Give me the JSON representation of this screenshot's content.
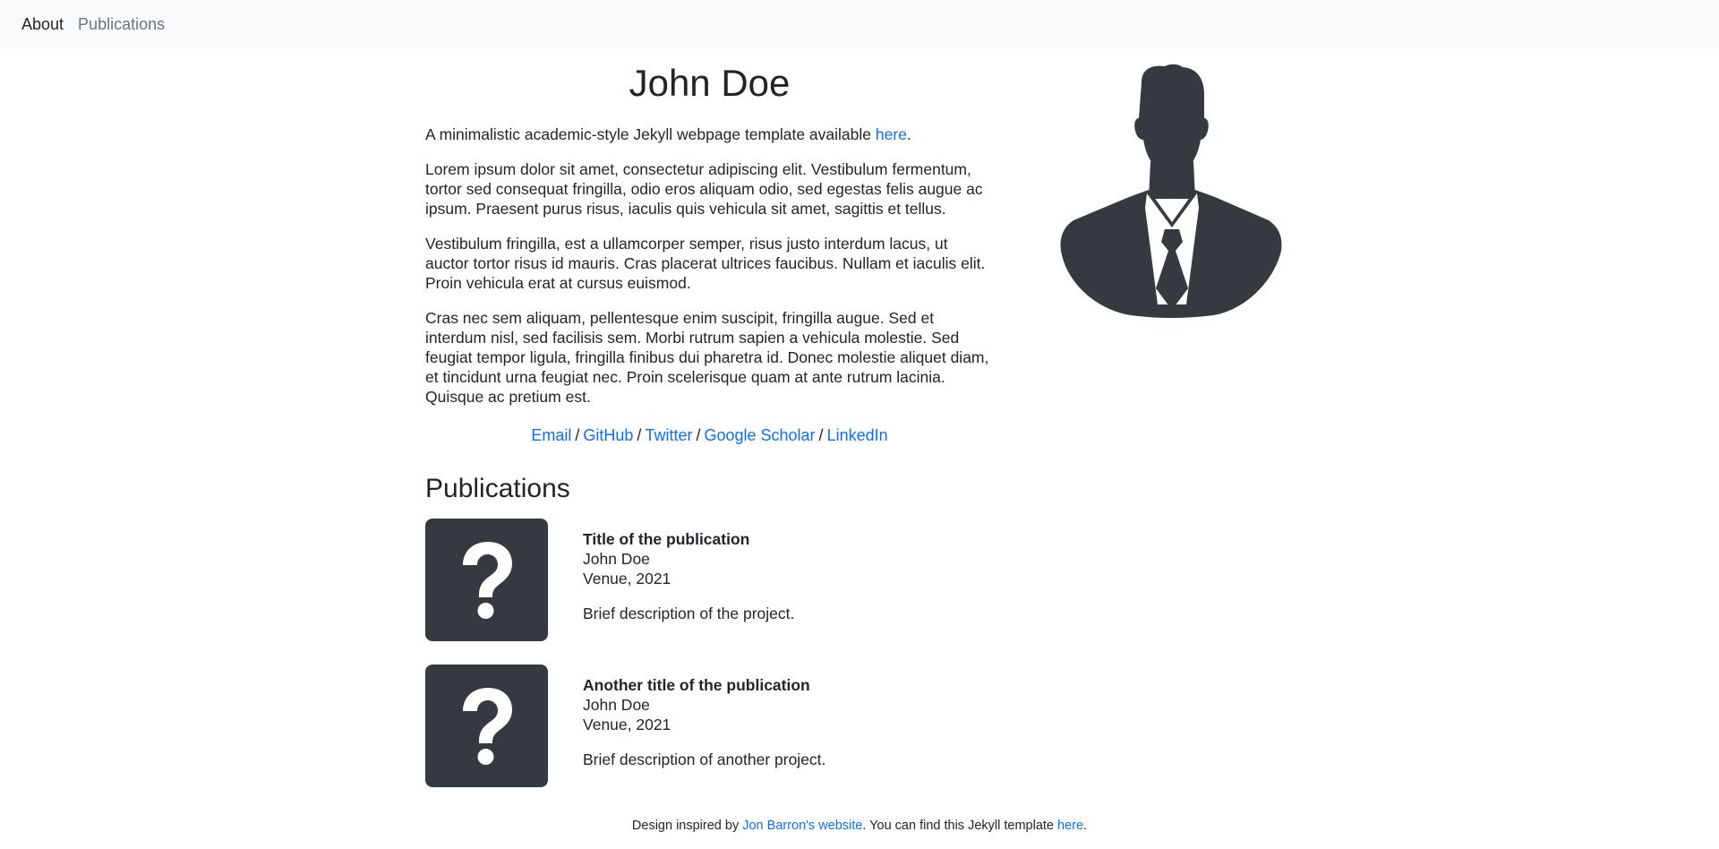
{
  "nav": {
    "items": [
      {
        "label": "About"
      },
      {
        "label": "Publications"
      }
    ]
  },
  "profile": {
    "name": "John Doe",
    "intro_prefix": "A minimalistic academic-style Jekyll webpage template available ",
    "intro_link": "here",
    "intro_suffix": ".",
    "paragraphs": [
      "Lorem ipsum dolor sit amet, consectetur adipiscing elit. Vestibulum fermentum, tortor sed consequat fringilla, odio eros aliquam odio, sed egestas felis augue ac ipsum. Praesent purus risus, iaculis quis vehicula sit amet, sagittis et tellus.",
      "Vestibulum fringilla, est a ullamcorper semper, risus justo interdum lacus, ut auctor tortor risus id mauris. Cras placerat ultrices faucibus. Nullam et iaculis elit. Proin vehicula erat at cursus euismod.",
      "Cras nec sem aliquam, pellentesque enim suscipit, fringilla augue. Sed et interdum nisl, sed facilisis sem. Morbi rutrum sapien a vehicula molestie. Sed feugiat tempor ligula, fringilla finibus dui pharetra id. Donec molestie aliquet diam, et tincidunt urna feugiat nec. Proin scelerisque quam at ante rutrum lacinia. Quisque ac pretium est."
    ],
    "links": [
      {
        "label": "Email"
      },
      {
        "label": "GitHub"
      },
      {
        "label": "Twitter"
      },
      {
        "label": "Google Scholar"
      },
      {
        "label": "LinkedIn"
      }
    ],
    "separator": "/",
    "avatar_icon": "person-silhouette-icon"
  },
  "publications": {
    "heading": "Publications",
    "items": [
      {
        "title": "Title of the publication",
        "authors": "John Doe",
        "venue": "Venue, 2021",
        "description": "Brief description of the project.",
        "thumb_icon": "question-mark-icon"
      },
      {
        "title": "Another title of the publication",
        "authors": "John Doe",
        "venue": "Venue, 2021",
        "description": "Brief description of another project.",
        "thumb_icon": "question-mark-icon"
      }
    ]
  },
  "footer": {
    "prefix": "Design inspired by ",
    "link1": "Jon Barron's website",
    "middle": ". You can find this Jekyll template ",
    "link2": "here",
    "suffix": "."
  },
  "colors": {
    "link": "#0d6efd",
    "navbar_bg": "#f8f9fa",
    "dark": "#343a40",
    "text": "#212529",
    "muted": "#6c757d"
  }
}
